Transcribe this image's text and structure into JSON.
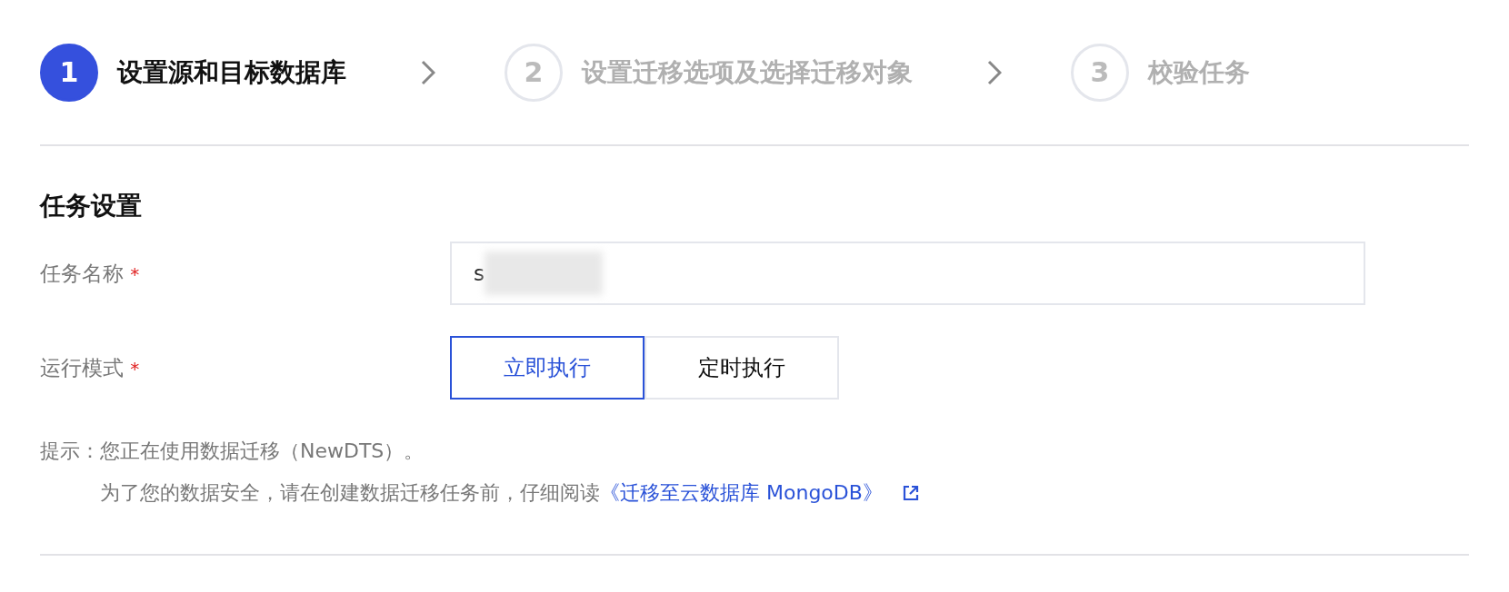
{
  "steps": [
    {
      "number": "1",
      "label": "设置源和目标数据库",
      "selected": true
    },
    {
      "number": "2",
      "label": "设置迁移选项及选择迁移对象",
      "selected": false
    },
    {
      "number": "3",
      "label": "校验任务",
      "selected": false
    }
  ],
  "section_title": "任务设置",
  "fields": [
    {
      "kind": "text",
      "label": "任务名称",
      "required_mark": "*",
      "value": "s",
      "redacted": true
    },
    {
      "kind": "segmented",
      "label": "运行模式",
      "required_mark": "*",
      "options": [
        {
          "label": "立即执行",
          "selected": true
        },
        {
          "label": "定时执行",
          "selected": false
        }
      ]
    }
  ],
  "hint": {
    "label": "提示：",
    "line_1": "您正在使用数据迁移（NewDTS）。",
    "line_2": "为了您的数据安全，请在创建数据迁移任务前，仔细阅读",
    "link": "《迁移至云数据库 MongoDB》"
  }
}
